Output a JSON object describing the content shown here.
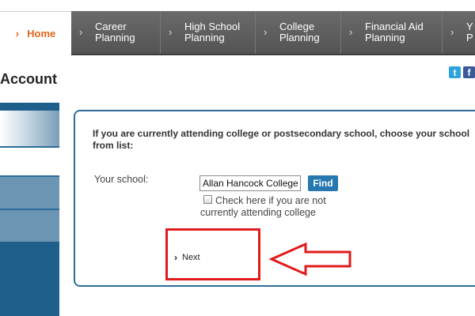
{
  "nav": {
    "home_label": "Home",
    "tabs": [
      {
        "label": "Career\nPlanning"
      },
      {
        "label": "High School\nPlanning"
      },
      {
        "label": "College\nPlanning"
      },
      {
        "label": "Financial Aid\nPlanning"
      },
      {
        "label": "Y\nP"
      }
    ]
  },
  "page": {
    "title": "Account"
  },
  "social": {
    "twitter": "t",
    "facebook": "f"
  },
  "form": {
    "instruction": "If you are currently attending college or postsecondary school, choose your school from list:",
    "school_label": "Your school:",
    "school_value": "Allan Hancock College",
    "find_label": "Find",
    "checkbox_label": "Check here if you are not currently attending college",
    "checkbox_checked": false,
    "next_label": "Next"
  },
  "colors": {
    "accent_orange": "#e0651a",
    "nav_gray": "#5f5f5f",
    "brand_blue": "#2b6d98",
    "button_blue": "#2777b0",
    "annotation_red": "#e01b1b"
  }
}
